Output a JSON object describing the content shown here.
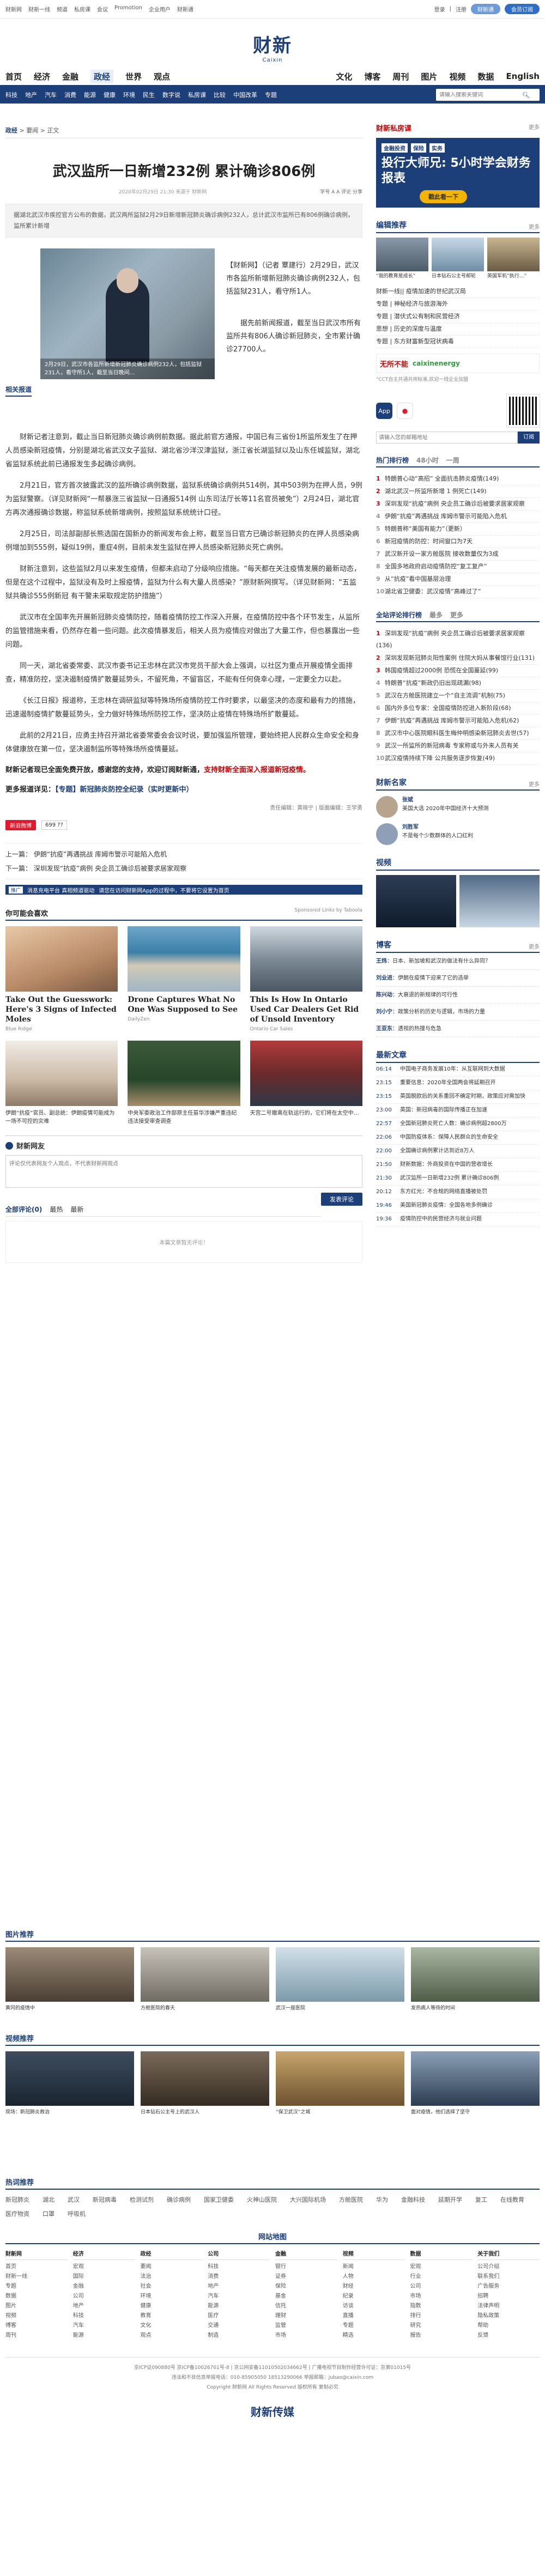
{
  "topbar": {
    "links": [
      "财新网",
      "财新一线",
      "频道",
      "私房课",
      "会议",
      "Promotion",
      "企业用户",
      "财新通"
    ],
    "login": "登录",
    "register": "注册",
    "btn1": "财新通",
    "btn2": "会员订阅"
  },
  "logo": {
    "cn": "财新",
    "en": "Caixin"
  },
  "nav1": {
    "items": [
      "首页",
      "经济",
      "金融",
      "政经",
      "世界",
      "观点",
      "文化",
      "博客",
      "周刊",
      "图片",
      "视频",
      "数据",
      "English"
    ],
    "active": "政经"
  },
  "nav2": {
    "items": [
      "科技",
      "地产",
      "汽车",
      "消费",
      "能源",
      "健康",
      "环境",
      "民生",
      "数字说",
      "私房课",
      "比较",
      "中国改革",
      "专题"
    ],
    "search_placeholder": "请输入搜索关键词"
  },
  "breadcrumb": {
    "a": "政经",
    "b": "要闻",
    "c": "正文"
  },
  "article": {
    "title": "武汉监所一日新增232例 累计确诊806例",
    "meta": "2020年02月29日 21:30 来源于 财新网",
    "tools": "字号 A A 评论 分享",
    "summary": "据湖北武汉市疾控官方公布的数据，武汉两所监狱2月29日新增新冠肺炎确诊病例232人，总计武汉市监所已有806例确诊病例，监所累计新增",
    "figure_caption": "2月29日，武汉市各监所新增新冠肺炎确诊病例232人，包括监狱231人，看守所1人，截至当日晚间…",
    "lead": "【财新网】（记者 覃建行）2月29日，武汉市各监所新增新冠肺炎确诊病例232人，包括监狱231人，看守所1人。",
    "lead2": "据先前新闻报道，截至当日武汉市所有监所共有806人确诊新冠肺炎，全市累计确诊27700人。",
    "paragraphs": [
      "财新记者注意到，截止当日新冠肺炎确诊病例前数据。据此前官方通报，中国已有三省份1所监所发生了在押人员感染新冠疫情，分别是湖北省武汉女子监狱、湖北省沙洋汉津监狱，浙江省长湖监狱以及山东任城监狱，湖北省监狱系统此前已通报发生多起确诊病例。",
      "2月21日，官方首次披露武汉的监所确诊病例数据，监狱系统确诊病例共514例，其中503例为在押人员，9例为监狱警察。（详见财新网“一帮暴涨三省监狱一日通报514例 山东司法厅长等11名官员被免”）2月24日，湖北官方再次通报确诊数据，称监狱系统新增病例，按照监狱系统统计口径。",
      "2月25日，司法部副部长熊选国在国新办的新闻发布会上称，截至当日官方已确诊新冠肺炎的在押人员感染病例增加到555例，疑似19例，重症4例，目前未发生监狱在押人员感染新冠肺炎死亡病例。",
      "财新注意到，这些监狱2月以来发生疫情，但都未启动了分级响应措施。“每天都在关注疫情发展的最新动态，但是在这个过程中，监狱没有及时上报疫情，监狱为什么有大量人员感染？”原财新网撰写。（详见财新网：“五监狱共确诊555例新冠 有干警未采取规定防护措施”）",
      "武汉市在全国率先开展新冠肺炎疫情防控，随着疫情防控工作深入开展，在疫情防控中各个环节发生，从监所的监管措施来看，仍然存在着一些问题。此次疫情暴发后，相关人员为疫情应对做出了大量工作，但也暴露出一些问题。",
      "同一天，湖北省委常委、武汉市委书记王忠林在武汉市党员干部大会上强调，以社区为重点开展疫情全面排查，精准防控，坚决遏制疫情扩散蔓延势头，不留死角，不留盲区，不能有任何侥幸心理，一定要全力以赴。",
      "《长江日报》报道称，王忠林在调研监狱等特殊场所疫情防控工作时要求，以最坚决的态度和最有力的措施，迅速遏制疫情扩散蔓延势头，全力做好特殊场所防控工作，坚决防止疫情在特殊场所扩散蔓延。",
      "此前的2月21日，应勇主持召开湖北省委常委会会议时说，要加强监所管理，要始终把人民群众生命安全和身体健康放在第一位，坚决遏制监所等特殊场所疫情蔓延。"
    ],
    "bold_note_a": "财新记者现已全面免费开放，感谢您的支持，欢迎订阅财新通，",
    "bold_note_b": "支持财新全面深入报道新冠疫情。",
    "topics_label": "更多报道详见：",
    "topics": "【专题】新冠肺炎防控全纪录（实时更新中）",
    "editor": "责任编辑：黄晓宁 | 版面编辑：王学勇",
    "weibo": "新浪微博",
    "likes": "699 ??",
    "prev": "上一篇： 伊朗“抗疫”再遇挑战 库姆市警示可能陷入危机",
    "next": "下一篇： 深圳发现“抗疫”病例 央企员工确诊后被要求居家观察",
    "ad_tag": "推广",
    "ad_text": "消息充电平台 真相频道驱动",
    "ad_text2": "请您在访问财新网App的过程中，不要将它设置为首页"
  },
  "sponsored": {
    "title": "你可能会喜欢",
    "by": "Sponsored Links by Taboola",
    "cards": [
      {
        "title": "Take Out the Guesswork: Here's 3 Signs of Infected Moles",
        "src": "Blue Ridge"
      },
      {
        "title": "Drone Captures What No One Was Supposed to See",
        "src": "DailyZen"
      },
      {
        "title": "This Is How In Ontario Used Car Dealers Get Rid of Unsold Inventory",
        "src": "Ontario Car Sales"
      }
    ]
  },
  "people": [
    "伊朗“抗疫”官员、副总统：伊朗疫情可能成为一场不可控的灾难",
    "中央军委政治工作部原主任苗华涉嫌严重违纪违法接受审查调查",
    "天宫二号撤离在轨运行的，它们将在太空中…"
  ],
  "comments": {
    "title": "财新网友",
    "placeholder": "评论仅代表网友个人观点，不代表财新网观点",
    "send": "发表评论",
    "tabs": [
      "全部评论(0)",
      "最热",
      "最新"
    ],
    "empty": "本篇文章暂无评论！"
  },
  "side": {
    "ad_title": "财新私房课",
    "ad_more": "更多",
    "ad_pills": [
      "金融投资",
      "保险",
      "实务"
    ],
    "ad_big": "投行大师兄: 5小时学会财务报表",
    "ad_btn": "戳此看一下",
    "photo_h": "编辑推荐",
    "photo_more": "更多",
    "photos": [
      "“我的教育是成长”",
      "日本钻石公主号邮轮",
      "英国军机”执行…”"
    ],
    "news": [
      "财新一线|| 疫情加速的世纪武汉局",
      "专题 | 神秘经济与旅游海外",
      "专题 | 潜伏式公有制和民营经济",
      "思想 | 历史的深度与温度",
      "专题 | 东方财富新型冠状病毒"
    ],
    "promo_g1": "无所不能",
    "promo_g2": "caixinenergy",
    "promo_note": "“CCT自主共通共用标准,欢迎一线企业加盟",
    "app": "App",
    "sub_placeholder": "请输入您的邮箱地址",
    "sub_btn": "订阅",
    "hot_tabs": [
      "热门排行榜",
      "48小时",
      "一周"
    ],
    "hot": [
      "特朗普心动“高招” 全面抗击肺炎疫情(149)",
      "湖北武汉一所监所新增 1 例死亡(149)",
      "深圳发现“抗疫”病例 央企员工确诊后被要求居家观察",
      "伊朗“抗疫”再遇挑战 库姆市警示可能陷入危机",
      "特朗普称“美国有能力”（更新）",
      "新冠疫情的防控：时间窗口为7天",
      "武汉新开设一家方舱医院 接收数量仅为3成",
      "全国多地政府启动疫情防控“复工复产”",
      "从“抗疫”看中国基层治理",
      "湖北省卫健委：武汉疫情“高峰过了”"
    ],
    "view_tabs": [
      "全站评论排行榜",
      "最多",
      "更多"
    ],
    "viewed": [
      "深圳发现“抗疫”病例 央企员工确诊后被要求居家观察(136)",
      "深圳发现新冠肺炎阳性案例 住院大妈从事餐馆行业(131)",
      "韩国疫情超过2000例 恐慌在全国蔓延(99)",
      "特朗普“抗疫”新政仍旧出现疏漏(98)",
      "武汉在方舱医院建立一个“自主流调”机制(75)",
      "国内外多位专家：全国疫情防控进入新阶段(68)",
      "伊朗“抗疫”再遇挑战 库姆市警示可能陷入危机(62)",
      "武汉市中心医院眼科医生梅仲明感染新冠肺炎去世(57)",
      "武汉一所监所的新冠病毒 专家称或与外来人员有关",
      "武汉疫情持续下降 公共服务逐步恢复(49)"
    ],
    "col_h": "财新名家",
    "col_more": "更多",
    "columns": [
      {
        "name": "张斌",
        "text": "美国大选 2020年中国经济十大预测"
      },
      {
        "name": "刘胜军",
        "text": "不是每个少数群体的人口红利"
      }
    ],
    "video_h": "视频",
    "blog_h": "博客",
    "blog_more": "更多",
    "blogs": [
      {
        "name": "王炜",
        "text": "日本、新加坡和武汉的做法有什么异同？"
      },
      {
        "name": "刘业进",
        "text": "伊朗在疫情下迎来了它的选举"
      },
      {
        "name": "陈兴动",
        "text": "大衰退的新规律的可行性"
      },
      {
        "name": "刘小宁",
        "text": "政策分析的历史与逻辑，市场的力量"
      },
      {
        "name": "王亚东",
        "text": "透视的热搜与危急"
      }
    ],
    "newest_h": "最新文章",
    "newest": [
      {
        "t": "06:14",
        "s": "中国电子商务发展10年：从互联网到大数据"
      },
      {
        "t": "23:15",
        "s": "重要信息：2020年全国两会将延期召开"
      },
      {
        "t": "23:15",
        "s": "英国脱欧后的关系重回不确定时期，政策应对需加快"
      },
      {
        "t": "23:00",
        "s": "英国：新冠病毒的国际传播正在加速"
      },
      {
        "t": "22:57",
        "s": "全国新冠肺炎死亡人数：确诊病例超2800万"
      },
      {
        "t": "22:06",
        "s": "中国防疫体系：保障人民群众的生命安全"
      },
      {
        "t": "22:00",
        "s": "全国确诊病例累计达到近8万人"
      },
      {
        "t": "21:50",
        "s": "财新数据：外商投资在中国的营收增长"
      },
      {
        "t": "21:30",
        "s": "武汉监所一日新增232例 累计确诊806例"
      },
      {
        "t": "20:12",
        "s": "东方红光：不合规的网络直播被处罚"
      },
      {
        "t": "19:46",
        "s": "美国新冠肺炎疫情：全国各地多例确诊"
      },
      {
        "t": "19:36",
        "s": "疫情防控中的民营经济与就业问题"
      }
    ]
  },
  "photos_h": "图片推荐",
  "photos_more": "更多",
  "photos_strip": [
    "黄冈的疫情中",
    "方舱医院的春天",
    "武汉一座医院",
    "发热病人等待的时间"
  ],
  "videos_h": "视频推荐",
  "videos_strip": [
    "现场：新冠肺炎救治",
    "日本钻石公主号上的武汉人",
    "“保卫武汉”之城",
    "面对疫情，他们选择了坚守"
  ],
  "hot_tags_h": "热词推荐",
  "hot_tags": [
    "新冠肺炎",
    "湖北",
    "武汉",
    "新冠病毒",
    "检测试剂",
    "确诊病例",
    "国家卫健委",
    "火神山医院",
    "大兴国际机场",
    "方舱医院",
    "华为",
    "金融科技",
    "延期开学",
    "复工",
    "在线教育",
    "医疗物资",
    "口罩",
    "呼吸机"
  ],
  "sitemap_h": "网站地图",
  "sitemap": [
    {
      "h": "财新网",
      "items": [
        "首页",
        "财新一线",
        "专题",
        "数据",
        "图片",
        "视频",
        "博客",
        "周刊"
      ]
    },
    {
      "h": "经济",
      "items": [
        "宏观",
        "国际",
        "金融",
        "公司",
        "地产",
        "科技",
        "汽车",
        "能源"
      ]
    },
    {
      "h": "政经",
      "items": [
        "要闻",
        "法治",
        "社会",
        "环境",
        "健康",
        "教育",
        "文化",
        "观点"
      ]
    },
    {
      "h": "公司",
      "items": [
        "科技",
        "消费",
        "地产",
        "汽车",
        "能源",
        "医疗",
        "交通",
        "制造"
      ]
    },
    {
      "h": "金融",
      "items": [
        "银行",
        "证券",
        "保险",
        "基金",
        "信托",
        "理财",
        "监管",
        "市场"
      ]
    },
    {
      "h": "视频",
      "items": [
        "新闻",
        "人物",
        "财经",
        "纪录",
        "访谈",
        "直播",
        "专题",
        "精选"
      ]
    },
    {
      "h": "数据",
      "items": [
        "宏观",
        "行业",
        "公司",
        "市场",
        "指数",
        "排行",
        "研究",
        "报告"
      ]
    },
    {
      "h": "关于我们",
      "items": [
        "公司介绍",
        "联系我们",
        "广告服务",
        "招聘",
        "法律声明",
        "隐私政策",
        "帮助",
        "反馈"
      ]
    }
  ],
  "footer": [
    "京ICP证090880号 京ICP备10026701号-8 | 京公网安备11010502034662号 | 广播电视节目制作经营许可证：京第01015号",
    "违法和不良信息举报电话：010-85905050 18513290066 举报邮箱：jubao@caixin.com",
    "Copyright 财新网 All Rights Reserved 版权所有 复制必究"
  ],
  "footer_logo": "财新传媒"
}
